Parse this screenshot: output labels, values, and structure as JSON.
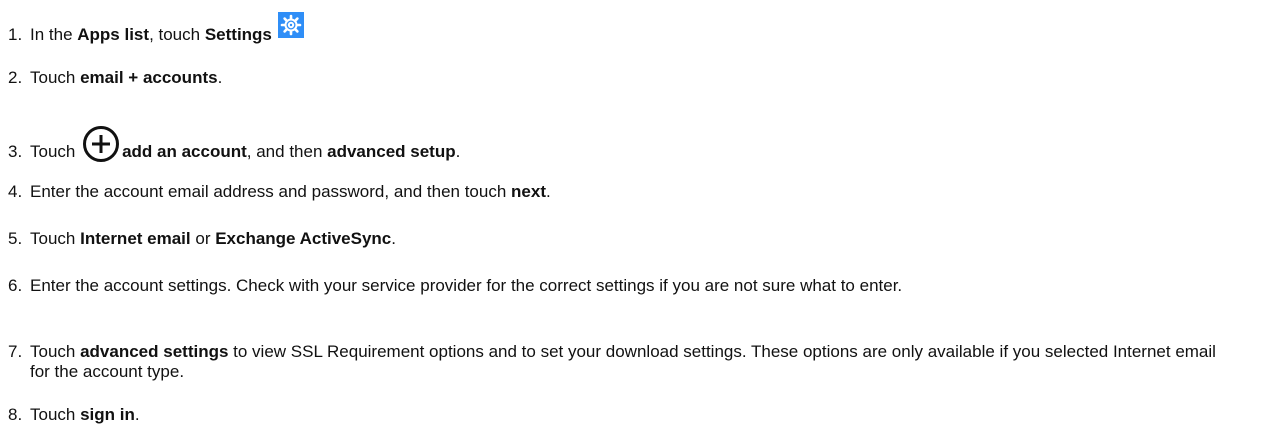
{
  "steps": [
    {
      "number": "1.",
      "parts": [
        "In the ",
        "Apps list",
        ", touch ",
        "Settings"
      ],
      "icon": "settings-gear-icon",
      "icon_color": "#2f8ef7"
    },
    {
      "number": "2.",
      "parts": [
        "Touch ",
        "email + accounts",
        "."
      ]
    },
    {
      "number": "3.",
      "parts": [
        "Touch ",
        "add an account",
        ", and then ",
        "advanced setup",
        "."
      ],
      "icon": "add-circle-icon"
    },
    {
      "number": "4.",
      "parts": [
        "Enter the account email address and password, and then touch ",
        "next",
        "."
      ]
    },
    {
      "number": "5.",
      "parts": [
        "Touch ",
        "Internet email",
        " or ",
        "Exchange ActiveSync",
        "."
      ]
    },
    {
      "number": "6.",
      "text": "Enter the account settings. Check with your service provider for the correct settings if you are not sure what to enter."
    },
    {
      "number": "7.",
      "parts": [
        "Touch ",
        "advanced settings",
        " to view SSL Requirement options and to set your download settings. These options are only available if you selected Internet email for the account type."
      ]
    },
    {
      "number": "8.",
      "parts": [
        "Touch ",
        "sign in",
        "."
      ]
    }
  ]
}
